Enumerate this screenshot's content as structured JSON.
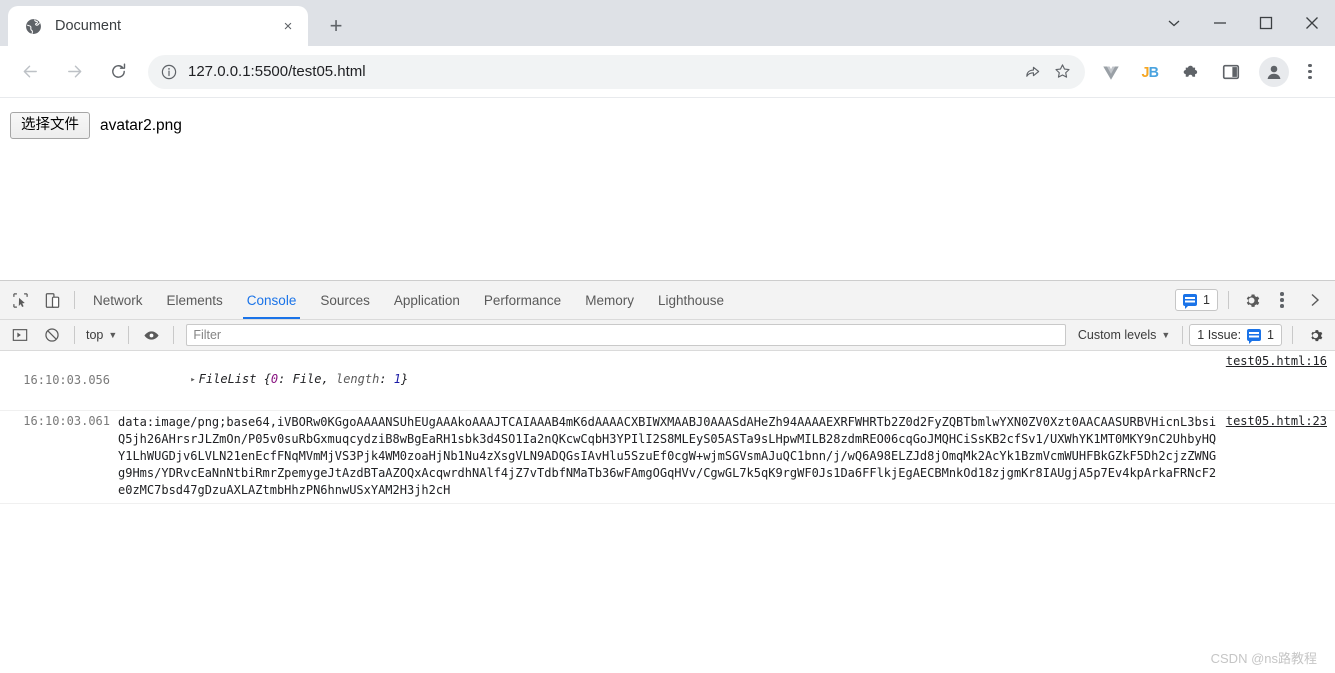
{
  "browser": {
    "tab": {
      "title": "Document",
      "favicon": "globe-icon",
      "close": "×"
    },
    "newtab_label": "+",
    "window_controls": {
      "minimize": "−",
      "maximize": "□",
      "close": "×",
      "chevron": "⌄"
    },
    "nav": {
      "back": "←",
      "forward": "→",
      "reload": "⟳"
    },
    "omnibox": {
      "info_icon": "info-circle-icon",
      "url": "127.0.0.1:5500/test05.html",
      "share_icon": "share-icon",
      "star_icon": "star-icon"
    },
    "extensions": [
      {
        "name": "vue-devtools-icon",
        "label": "V"
      },
      {
        "name": "jetbrains-icon",
        "label": "JB"
      },
      {
        "name": "puzzle-extensions-icon",
        "label": "✦"
      },
      {
        "name": "sidepanel-icon",
        "label": "□"
      }
    ],
    "avatar": "profile-avatar-icon",
    "menu": "three-dot-menu-icon"
  },
  "page": {
    "file_input": {
      "button_label": "选择文件",
      "file_name": "avatar2.png"
    }
  },
  "devtools": {
    "inspect_icon": "inspect-element-icon",
    "device_icon": "device-toolbar-icon",
    "tabs": [
      {
        "label": "Network",
        "active": false
      },
      {
        "label": "Elements",
        "active": false
      },
      {
        "label": "Console",
        "active": true
      },
      {
        "label": "Sources",
        "active": false
      },
      {
        "label": "Application",
        "active": false
      },
      {
        "label": "Performance",
        "active": false
      },
      {
        "label": "Memory",
        "active": false
      },
      {
        "label": "Lighthouse",
        "active": false
      }
    ],
    "message_count": "1",
    "settings_icon": "gear-icon",
    "more_icon": "three-dot-menu-icon",
    "chevron_icon": "chevron-right-icon",
    "toolbar": {
      "sidebar_icon": "console-sidebar-icon",
      "clear_icon": "clear-console-icon",
      "context": "top",
      "eye_icon": "live-expression-eye-icon",
      "filter_placeholder": "Filter",
      "levels": "Custom levels",
      "issues_label": "1 Issue:",
      "issues_count": "1"
    },
    "console_rows": [
      {
        "timestamp": "16:10:03.056",
        "disclosure": "▸",
        "object_name": "FileList",
        "object_open": " {",
        "object_key": "0",
        "object_sep": ": ",
        "object_val": "File",
        "object_comma": ", ",
        "object_key2": "length",
        "object_sep2": ": ",
        "object_num": "1",
        "object_close": "}",
        "source": "test05.html:16"
      },
      {
        "timestamp": "16:10:03.061",
        "text": "data:image/png;base64,iVBORw0KGgoAAAANSUhEUgAAAkoAAAJTCAIAAAB4mK6dAAAACXBIWXMAABJ0AAASdAHeZh94AAAAEXRFWHRTb2Z0d2FyZQBTbmlwYXN0ZV0Xzt0AACAASURBVHicnL3bsiQ5jh26AHrsrJLZmOn/P05v0suRbGxmuqcydziB8wBgEaRH1sbk3d4SO1Ia2nQKcwCqbH3YPIlI2S8MLEyS05ASTa9sLHpwMILB28zdmREO06cqGoJMQHCiSsKB2cfSv1/UXWhYK1MT0MKY9nC2UhbyHQY1LhWUGDjv6LVLN21enEcfFNqMVmMjVS3Pjk4WM0zoaHjNb1Nu4zXsgVLN9ADQGsIAvHlu5SzuEf0cgW+wjmSGVsmAJuQC1bnn/j/wQ6A98ELZJd8jOmqMk2AcYk1BzmVcmWUHFBkGZkF5Dh2cjzZWNGg9Hms/YDRvcEaNnNtbiRmrZpemygeJtAzdBTaAZOQxAcqwrdhNAlf4jZ7vTdbfNMaTb36wFAmgOGqHVv/CgwGL7k5qK9rgWF0Js1Da6FFlkjEgAECBMnkOd18zjgmKr8IAUgjA5p7Ev4kpArkaFRNcF2e0zMC7bsd47gDzuAXLAZtmbHhzPN6hnwUSxYAM2H3jh2cH",
        "source": "test05.html:23"
      }
    ],
    "watermark": "CSDN @ns路教程"
  }
}
